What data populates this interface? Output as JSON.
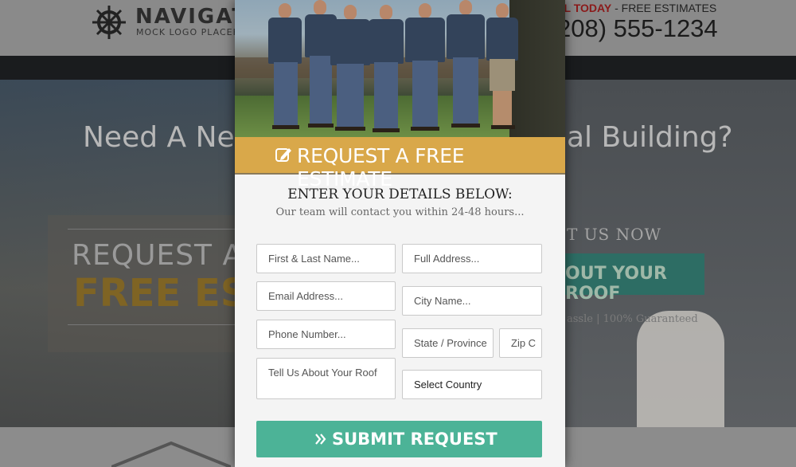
{
  "background": {
    "logo": {
      "name": "NAVIGATO",
      "subtitle": "MOCK LOGO PLACEHOLE"
    },
    "call": {
      "highlight": "LL TODAY",
      "rest": " - FREE ESTIMATES"
    },
    "phone": "208) 555-1234",
    "hero_title_left": "Need A New",
    "hero_title_right": "al Building?",
    "request_line1": "REQUEST A",
    "request_line2": "FREE ES",
    "contact_now": "T US NOW",
    "roof_button": "OUT YOUR ROOF",
    "guarantee": "assle | 100% Guaranteed"
  },
  "modal": {
    "banner": {
      "icon": "edit-icon",
      "title": "REQUEST A FREE ESTIMATE"
    },
    "heading": "ENTER YOUR DETAILS BELOW:",
    "subheading": "Our team will contact you within 24-48 hours...",
    "fields": {
      "name": "First & Last Name...",
      "email": "Email Address...",
      "phone": "Phone Number...",
      "message": "Tell Us About Your Roof",
      "address": "Full Address...",
      "city": "City Name...",
      "state": "State / Province",
      "zip": "Zip C",
      "country": "Select Country"
    },
    "submit": {
      "icon": "double-chevron-right-icon",
      "label": "SUBMIT REQUEST"
    }
  },
  "colors": {
    "banner": "#d9a84a",
    "submit": "#4cb397",
    "accent_red": "#8b1a1a"
  }
}
